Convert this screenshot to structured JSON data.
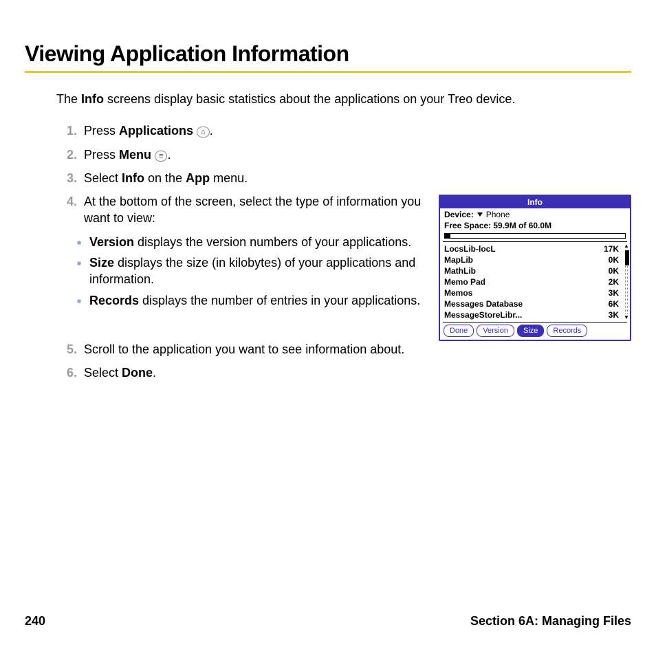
{
  "heading": "Viewing Application Information",
  "intro": {
    "pre": "The ",
    "bold": "Info",
    "post": " screens display basic statistics about the applications on your Treo device."
  },
  "steps": {
    "s1": {
      "num": "1.",
      "pre": "Press ",
      "b": "Applications",
      "post": " ",
      "icon": "⌂",
      "tail": "."
    },
    "s2": {
      "num": "2.",
      "pre": "Press ",
      "b": "Menu",
      "post": " ",
      "icon": "≡",
      "tail": "."
    },
    "s3": {
      "num": "3.",
      "pre": "Select ",
      "b1": "Info",
      "mid": " on the ",
      "b2": "App",
      "post": " menu."
    },
    "s4": {
      "num": "4.",
      "text": "At the bottom of the screen, select the type of information you want to view:"
    },
    "s5": {
      "num": "5.",
      "text": "Scroll to the application you want to see information about."
    },
    "s6": {
      "num": "6.",
      "pre": "Select ",
      "b": "Done",
      "post": "."
    }
  },
  "bullets": {
    "b1": {
      "bold": "Version",
      "rest": " displays the version numbers of your applications."
    },
    "b2": {
      "bold": "Size",
      "rest": " displays the size (in kilobytes) of your applications and information."
    },
    "b3": {
      "bold": "Records",
      "rest": " displays the number of entries in your applications."
    }
  },
  "figure": {
    "title": "Info",
    "device_label": "Device:",
    "device_value": "Phone",
    "free_space": "Free Space: 59.9M of 60.0M",
    "apps": [
      {
        "name": "LocsLib-locL",
        "size": "17K"
      },
      {
        "name": "MapLib",
        "size": "0K"
      },
      {
        "name": "MathLib",
        "size": "0K"
      },
      {
        "name": "Memo Pad",
        "size": "2K"
      },
      {
        "name": "Memos",
        "size": "3K"
      },
      {
        "name": "Messages Database",
        "size": "6K"
      },
      {
        "name": "MessageStoreLibr...",
        "size": "3K"
      }
    ],
    "buttons": {
      "done": "Done",
      "version": "Version",
      "size": "Size",
      "records": "Records"
    }
  },
  "footer": {
    "page": "240",
    "section": "Section 6A: Managing Files"
  }
}
